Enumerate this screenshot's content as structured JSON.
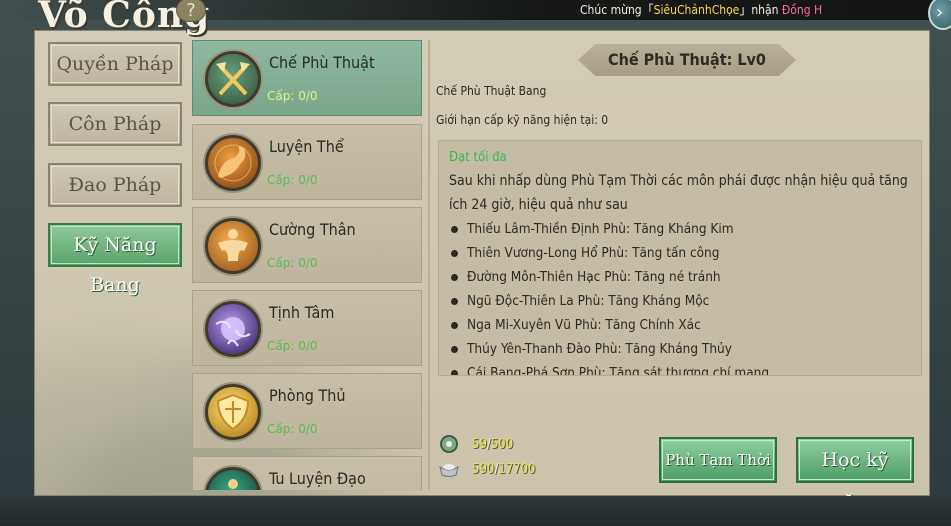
{
  "window": {
    "title": "Võ Công",
    "help_label": "?"
  },
  "announcement": {
    "prefix": "Chúc mừng「",
    "player": "SiêuChảnhChọe",
    "middle": "」nhận ",
    "reward": "Đồng H"
  },
  "categories": [
    {
      "label": "Quyền Pháp"
    },
    {
      "label": "Côn Pháp"
    },
    {
      "label": "Đao Pháp"
    },
    {
      "label": "Kỹ Năng Bang"
    }
  ],
  "skills": [
    {
      "name": "Chế Phù Thuật",
      "level": "Cấp: 0/0",
      "icon": "crossed-axes-icon",
      "color": "#c8a23c"
    },
    {
      "name": "Luyện Thể",
      "level": "Cấp: 0/0",
      "icon": "flexed-arm-icon",
      "color": "#d26a1c"
    },
    {
      "name": "Cường Thân",
      "level": "Cấp: 0/0",
      "icon": "muscle-body-icon",
      "color": "#e08a2a"
    },
    {
      "name": "Tịnh Tâm",
      "level": "Cấp: 0/0",
      "icon": "purple-orb-icon",
      "color": "#7a54c8"
    },
    {
      "name": "Phòng Thủ",
      "level": "Cấp: 0/0",
      "icon": "shield-icon",
      "color": "#e3b12a"
    },
    {
      "name": "Tu Luyện Đạo",
      "level": "",
      "icon": "meditation-figure-icon",
      "color": "#2a8a6a"
    }
  ],
  "detail": {
    "title": "Chế Phù Thuật: Lv0",
    "category": "Chế Phù Thuật Bang",
    "limit": "Giới hạn cấp kỹ năng hiện tại: 0",
    "status": "Đạt tối đa",
    "description": "Sau khi nhấp dùng Phù Tạm Thời các môn phái được nhận hiệu quả tăng ích 24 giờ, hiệu quả như sau",
    "effects": [
      "Thiếu Lâm-Thiền Định Phù: Tăng Kháng Kim",
      "Thiên Vương-Long Hổ Phù: Tăng tấn công",
      "Đường Môn-Thiên Hạc Phù: Tăng né tránh",
      "Ngũ Độc-Thiên La Phù: Tăng Kháng Mộc",
      "Nga Mi-Xuyên Vũ Phù: Tăng Chính Xác",
      "Thúy Yên-Thanh Đào Phù: Tăng Kháng Thủy",
      "Cái Bang-Phá Sơn Phù: Tăng sát thương chí mạng"
    ]
  },
  "resources": [
    {
      "icon": "guild-contribution-icon",
      "current": "59",
      "max": "500"
    },
    {
      "icon": "silver-ingot-icon",
      "current": "590",
      "max": "17700"
    }
  ],
  "actions": {
    "temp_talisman": "Phù Tạm Thời",
    "learn_skill": "Học kỹ năng"
  },
  "colors": {
    "active_green": "#5aa46d",
    "level_green": "#5ab84a",
    "panel_bg": "#d3ccb6"
  }
}
